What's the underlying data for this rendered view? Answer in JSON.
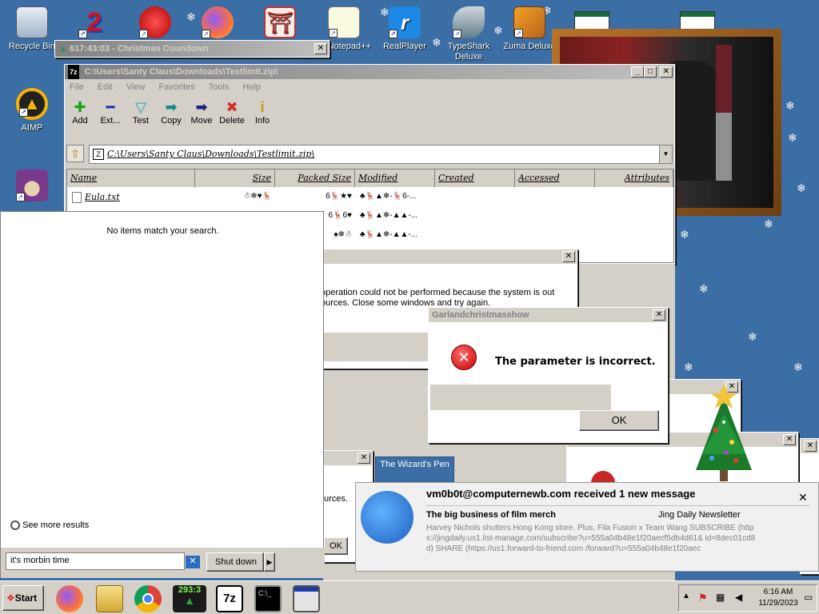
{
  "colors": {
    "desktop": "#3a6ea5",
    "title_active": "#0a246a",
    "error": "#d32f2f"
  },
  "desktop_icons": [
    {
      "label": "Recycle Bin",
      "icon": "recycle-bin-icon"
    },
    {
      "label": "AIMP",
      "icon": "aimp-icon"
    },
    {
      "label": "",
      "icon": "wizard-icon"
    },
    {
      "label": "",
      "icon": "number-2-icon"
    },
    {
      "label": "",
      "icon": "red-monster-icon"
    },
    {
      "label": "",
      "icon": "firefox-icon"
    },
    {
      "label": "",
      "icon": "torii-gate-icon"
    },
    {
      "label": "Notepad++",
      "icon": "notepadpp-icon"
    },
    {
      "label": "RealPlayer",
      "icon": "realplayer-icon"
    },
    {
      "label": "TypeShark Deluxe",
      "icon": "shark-icon"
    },
    {
      "label": "Zuma Deluxe",
      "icon": "zuma-icon"
    }
  ],
  "countdown_window": {
    "title": "617:43:03 - Christmas Coundown"
  },
  "sevenzip": {
    "title": "C:\\Users\\Santy Claus\\Downloads\\Testlimit.zip\\",
    "menu": [
      "File",
      "Edit",
      "View",
      "Favorites",
      "Tools",
      "Help"
    ],
    "toolbar": [
      {
        "label": "Add",
        "icon": "add-icon"
      },
      {
        "label": "Ext...",
        "icon": "extract-icon"
      },
      {
        "label": "Test",
        "icon": "test-icon"
      },
      {
        "label": "Copy",
        "icon": "copy-icon"
      },
      {
        "label": "Move",
        "icon": "move-icon"
      },
      {
        "label": "Delete",
        "icon": "delete-icon"
      },
      {
        "label": "Info",
        "icon": "info-icon"
      }
    ],
    "address": "C:\\Users\\Santy Claus\\Downloads\\Testlimit.zip\\",
    "columns": [
      "Name",
      "Size",
      "Packed Size",
      "Modified",
      "Created",
      "Accessed",
      "Attributes"
    ],
    "rows": [
      {
        "name": "Eula.txt",
        "size": "☃❄♥🦌",
        "packed": "6🦌★♥",
        "modified": "♣🦌▲❄-🦌6-..."
      },
      {
        "name": "",
        "size": "",
        "packed": "6🦌6♥",
        "modified": "♣🦌▲❄-▲▲-..."
      },
      {
        "name": "",
        "size": "",
        "packed": "♠❄☃",
        "modified": "♣🦌▲❄-▲▲-..."
      }
    ]
  },
  "error_window_back": {
    "title_fragment": "r",
    "text_line1": "operation could not be performed because the system is out",
    "text_line2": "ources. Close some windows and try again."
  },
  "error_window_small": {
    "text": "urces.",
    "ok": "OK"
  },
  "garland_dialog": {
    "title": "Garlandchristmasshow",
    "message": "The parameter is incorrect.",
    "ok": "OK"
  },
  "wizards_pen": {
    "label": "The Wizard's Pen"
  },
  "search": {
    "empty_message": "No items match your search.",
    "see_more": "See more results",
    "query": "it's morbin time",
    "shutdown": "Shut down"
  },
  "notification": {
    "header": "vm0b0t@computernewb.com received 1 new message",
    "subject": "The big business of film merch",
    "sender": "Jing Daily Newsletter",
    "preview": "Harvey Nichols shutters Hong Kong store. Plus, Fila Fusion x Team Wang SUBSCRIBE (https://jingdaily.us1.list-manage.com/subscribe?u=555a04b48e1f20aecf5db4d61& id=8dec01cd8d) SHARE (https://us1.forward-to-friend.com /forward?u=555a04b48e1f20aec"
  },
  "taskbar": {
    "start": "Start",
    "countdown_badge": "293:3",
    "time": "6:16 AM",
    "date": "11/29/2023"
  }
}
